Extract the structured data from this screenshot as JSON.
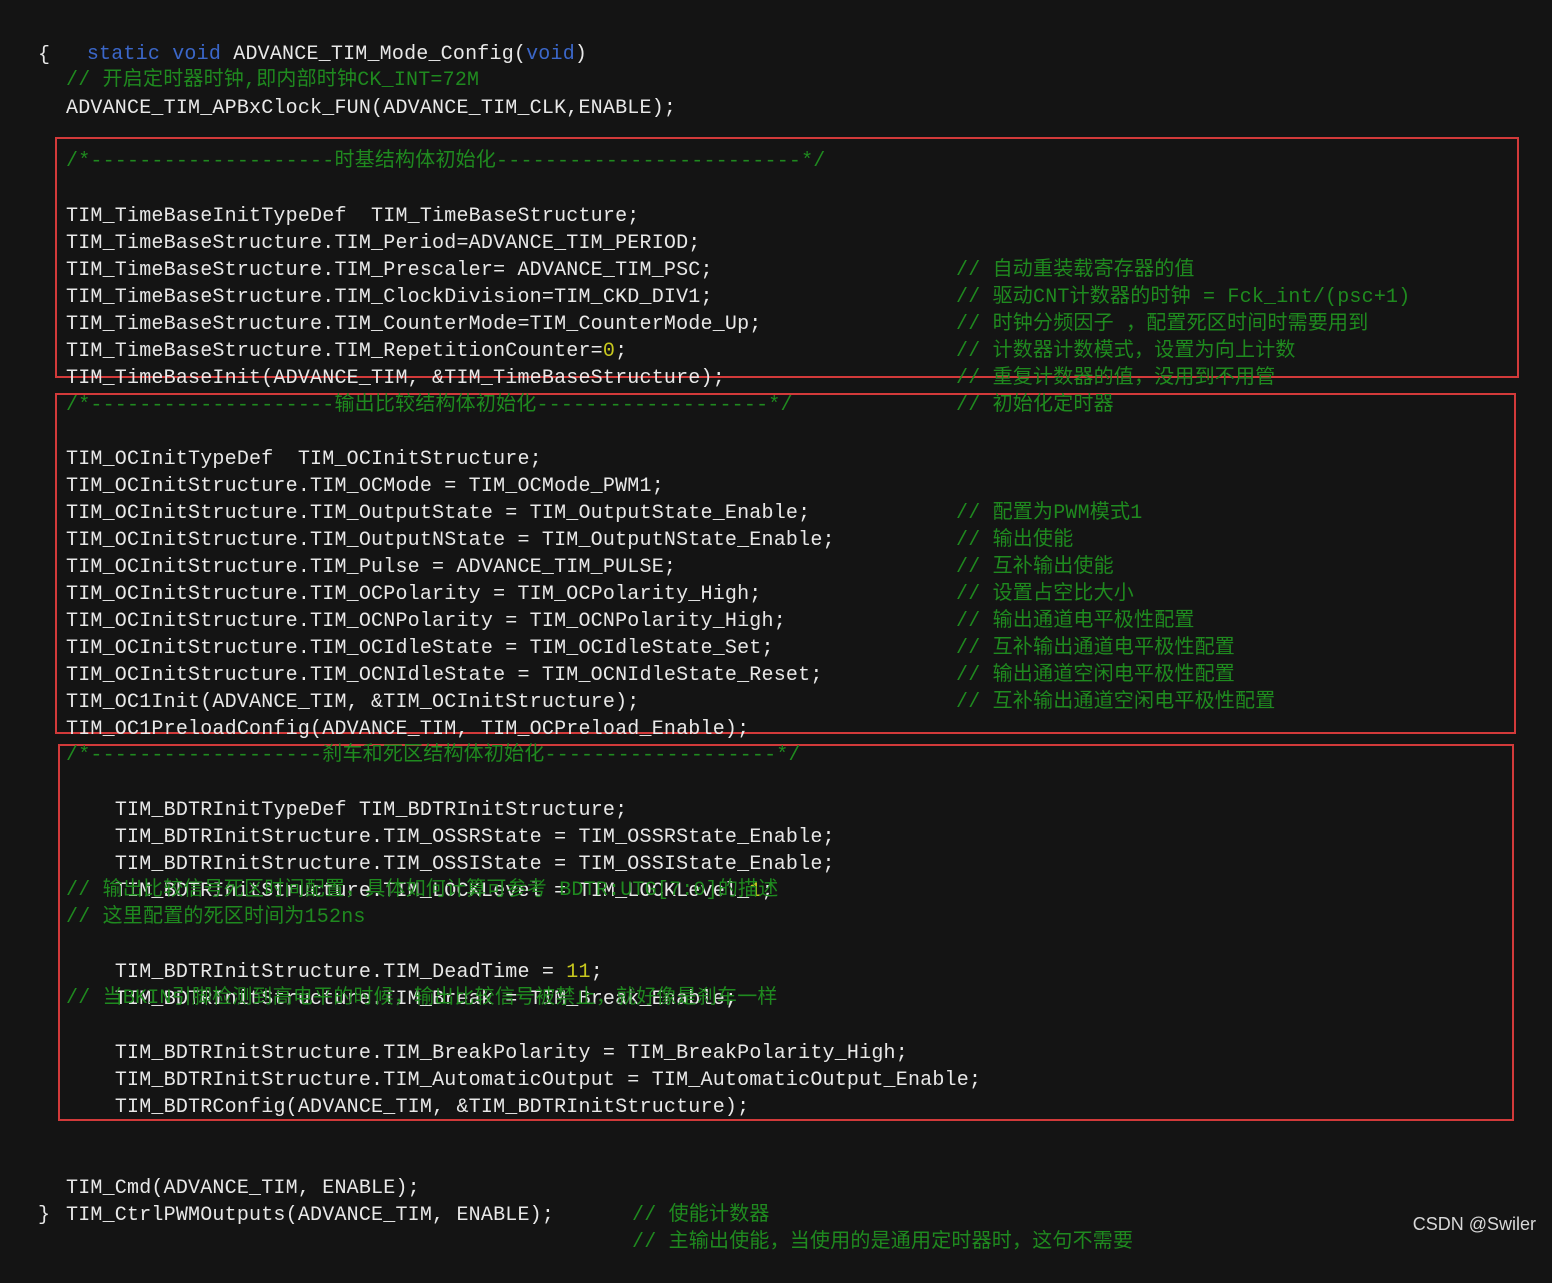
{
  "header": {
    "kw_static": "static",
    "kw_void": "void",
    "func_name": "ADVANCE_TIM_Mode_Config",
    "paren_open": "(",
    "param_void": "void",
    "paren_close": ")",
    "brace_open": "{"
  },
  "intro": {
    "comment": "// 开启定时器时钟,即内部时钟CK_INT=72M",
    "code": "ADVANCE_TIM_APBxClock_FUN(ADVANCE_TIM_CLK,ENABLE);"
  },
  "timebase": {
    "header": "/*--------------------时基结构体初始化-------------------------*/",
    "lines": [
      {
        "code": "TIM_TimeBaseInitTypeDef  TIM_TimeBaseStructure;",
        "comment": ""
      },
      {
        "code": "TIM_TimeBaseStructure.TIM_Period=ADVANCE_TIM_PERIOD;",
        "comment": "// 自动重装载寄存器的值"
      },
      {
        "code": "TIM_TimeBaseStructure.TIM_Prescaler= ADVANCE_TIM_PSC;",
        "comment": "// 驱动CNT计数器的时钟 = Fck_int/(psc+1)"
      },
      {
        "code": "TIM_TimeBaseStructure.TIM_ClockDivision=TIM_CKD_DIV1;",
        "comment": "// 时钟分频因子 ，配置死区时间时需要用到"
      },
      {
        "code": "TIM_TimeBaseStructure.TIM_CounterMode=TIM_CounterMode_Up;",
        "comment": "// 计数器计数模式，设置为向上计数"
      },
      {
        "code": "TIM_TimeBaseStructure.TIM_RepetitionCounter=",
        "num": "0",
        "tail": ";",
        "comment": "// 重复计数器的值，没用到不用管"
      },
      {
        "code": "TIM_TimeBaseInit(ADVANCE_TIM, &TIM_TimeBaseStructure);",
        "comment": "// 初始化定时器"
      }
    ]
  },
  "oc": {
    "header": "/*--------------------输出比较结构体初始化-------------------*/",
    "lines": [
      {
        "code": "TIM_OCInitTypeDef  TIM_OCInitStructure;",
        "comment": ""
      },
      {
        "code": "TIM_OCInitStructure.TIM_OCMode = TIM_OCMode_PWM1;",
        "comment": "// 配置为PWM模式1"
      },
      {
        "code": "TIM_OCInitStructure.TIM_OutputState = TIM_OutputState_Enable;",
        "comment": "// 输出使能"
      },
      {
        "code": "TIM_OCInitStructure.TIM_OutputNState = TIM_OutputNState_Enable;",
        "comment": "// 互补输出使能"
      },
      {
        "code": "TIM_OCInitStructure.TIM_Pulse = ADVANCE_TIM_PULSE;",
        "comment": "// 设置占空比大小"
      },
      {
        "code": "TIM_OCInitStructure.TIM_OCPolarity = TIM_OCPolarity_High;",
        "comment": "// 输出通道电平极性配置"
      },
      {
        "code": "TIM_OCInitStructure.TIM_OCNPolarity = TIM_OCNPolarity_High;",
        "comment": "// 互补输出通道电平极性配置"
      },
      {
        "code": "TIM_OCInitStructure.TIM_OCIdleState = TIM_OCIdleState_Set;",
        "comment": "// 输出通道空闲电平极性配置"
      },
      {
        "code": "TIM_OCInitStructure.TIM_OCNIdleState = TIM_OCNIdleState_Reset;",
        "comment": "// 互补输出通道空闲电平极性配置"
      },
      {
        "code": "TIM_OC1Init(ADVANCE_TIM, &TIM_OCInitStructure);",
        "comment": ""
      },
      {
        "code": "TIM_OC1PreloadConfig(ADVANCE_TIM, TIM_OCPreload_Enable);",
        "comment": ""
      }
    ]
  },
  "bdtr": {
    "header": "/*-------------------刹车和死区结构体初始化-------------------*/",
    "lines": [
      {
        "code": "TIM_BDTRInitTypeDef TIM_BDTRInitStructure;"
      },
      {
        "code": "TIM_BDTRInitStructure.TIM_OSSRState = TIM_OSSRState_Enable;"
      },
      {
        "code": "TIM_BDTRInitStructure.TIM_OSSIState = TIM_OSSIState_Enable;"
      },
      {
        "code": "TIM_BDTRInitStructure.TIM_LOCKLevel = TIM_LOCKLevel_",
        "num": "1",
        "tail": ";"
      },
      {
        "comment": "// 输出比较信号死区时间配置，具体如何计算可参考 BDTR:UTG[7:0]的描述"
      },
      {
        "comment": "// 这里配置的死区时间为152ns"
      },
      {
        "code": "TIM_BDTRInitStructure.TIM_DeadTime = ",
        "num": "11",
        "tail": ";"
      },
      {
        "code": "TIM_BDTRInitStructure.TIM_Break = TIM_Break_Enable;"
      },
      {
        "comment": "// 当BKIN引脚检测到高电平的时候，输出比较信号被禁止，就好像是刹车一样"
      },
      {
        "code": "TIM_BDTRInitStructure.TIM_BreakPolarity = TIM_BreakPolarity_High;"
      },
      {
        "code": "TIM_BDTRInitStructure.TIM_AutomaticOutput = TIM_AutomaticOutput_Enable;"
      },
      {
        "code": "TIM_BDTRConfig(ADVANCE_TIM, &TIM_BDTRInitStructure);"
      }
    ]
  },
  "footer": {
    "lines": [
      {
        "code": "TIM_Cmd(ADVANCE_TIM, ENABLE);",
        "comment": "// 使能计数器"
      },
      {
        "code": "TIM_CtrlPWMOutputs(ADVANCE_TIM, ENABLE);",
        "comment": "// 主输出使能，当使用的是通用定时器时，这句不需要"
      }
    ],
    "brace_close": "}"
  },
  "watermark": "CSDN @Swiler",
  "colors": {
    "background": "#141414",
    "code": "#e8e8e8",
    "comment": "#1f8a1f",
    "keyword": "#3b67c9",
    "number": "#c8c81e",
    "highlight_box": "#d23a3a"
  }
}
